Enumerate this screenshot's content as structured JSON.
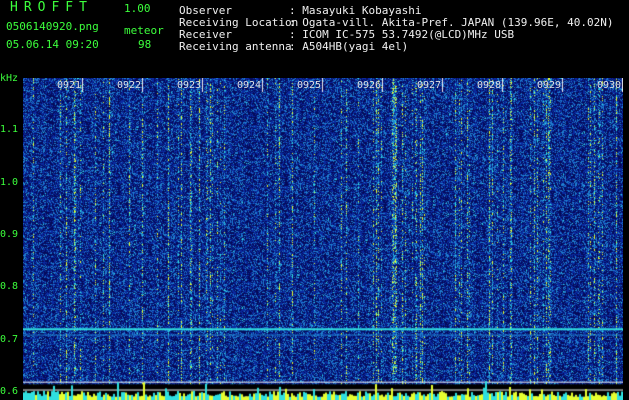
{
  "header": {
    "app_title": "HROFFT",
    "app_version": "1.00",
    "file_name": "0506140920.png",
    "meteor_label": "meteor",
    "datetime": "05.06.14 09:20",
    "meteor_count": "98"
  },
  "info": {
    "rows": [
      {
        "label": "Observer",
        "value": ": Masayuki Kobayashi"
      },
      {
        "label": "Receiving Location",
        "value": ": Ogata-vill. Akita-Pref. JAPAN (139.96E, 40.02N)"
      },
      {
        "label": "Receiver",
        "value": ": ICOM IC-575 53.7492(@LCD)MHz USB"
      },
      {
        "label": "Receiving antenna",
        "value": ": A504HB(yagi 4el)"
      }
    ]
  },
  "spectrogram": {
    "y_unit": "kHz",
    "y_ticks": [
      "1.1",
      "1.0",
      "0.9",
      "0.8",
      "0.7",
      "0.6"
    ],
    "y_tick_values": [
      1.1,
      1.0,
      0.9,
      0.8,
      0.7,
      0.6
    ],
    "y_range_khz": [
      0.585,
      1.2
    ],
    "time_labels": [
      "0921",
      "0922",
      "0923",
      "0924",
      "0925",
      "0926",
      "0927",
      "0928",
      "0929",
      "0930"
    ],
    "colors": {
      "background": "#050a5a",
      "noise_low": "#0a2aa0",
      "noise_mid": "#1f7fd0",
      "noise_high": "#30e0e0",
      "peak": "#e6ff30",
      "text_green": "#3cff3c",
      "text_white": "#f0f0f0"
    }
  }
}
